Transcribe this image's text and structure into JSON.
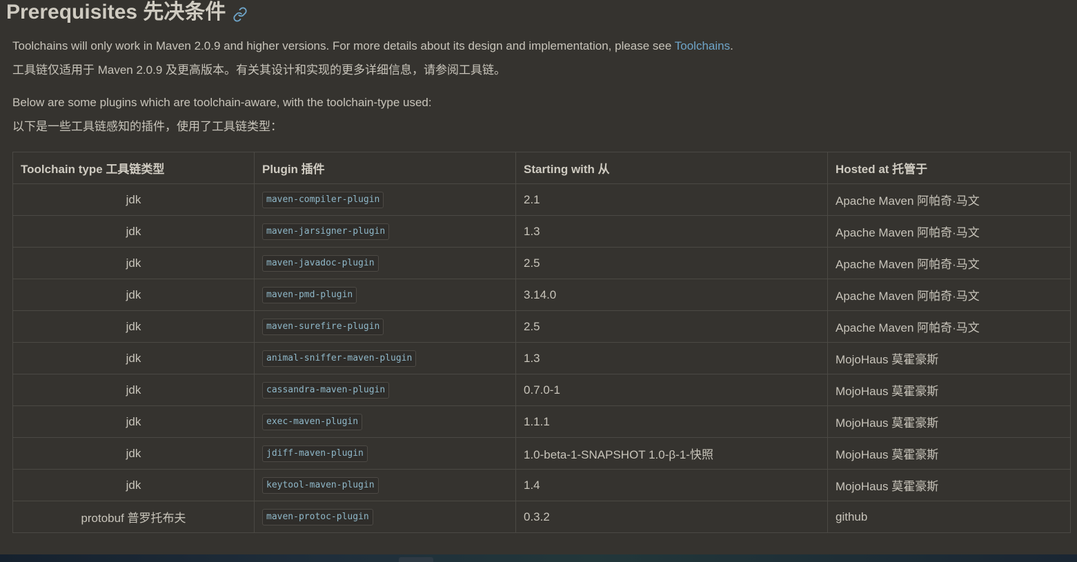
{
  "heading": {
    "text": "Prerequisites 先决条件",
    "icon": "link-icon"
  },
  "paragraphs": {
    "p1_before": "Toolchains will only work in Maven 2.0.9 and higher versions. For more details about its design and implementation, please see ",
    "p1_link": "Toolchains",
    "p1_after": ".",
    "p2": "工具链仅适用于 Maven 2.0.9 及更高版本。有关其设计和实现的更多详细信息，请参阅工具链。",
    "p3": "Below are some plugins which are toolchain-aware, with the toolchain-type used:",
    "p4": "以下是一些工具链感知的插件，使用了工具链类型："
  },
  "table": {
    "headers": {
      "type": "Toolchain type 工具链类型",
      "plugin": "Plugin 插件",
      "starting": "Starting with 从",
      "hosted": "Hosted at 托管于"
    },
    "rows": [
      {
        "type": "jdk",
        "plugin": "maven-compiler-plugin",
        "starting": "2.1",
        "hosted": "Apache Maven 阿帕奇·马文"
      },
      {
        "type": "jdk",
        "plugin": "maven-jarsigner-plugin",
        "starting": "1.3",
        "hosted": "Apache Maven 阿帕奇·马文"
      },
      {
        "type": "jdk",
        "plugin": "maven-javadoc-plugin",
        "starting": "2.5",
        "hosted": "Apache Maven 阿帕奇·马文"
      },
      {
        "type": "jdk",
        "plugin": "maven-pmd-plugin",
        "starting": "3.14.0",
        "hosted": "Apache Maven 阿帕奇·马文"
      },
      {
        "type": "jdk",
        "plugin": "maven-surefire-plugin",
        "starting": "2.5",
        "hosted": "Apache Maven 阿帕奇·马文"
      },
      {
        "type": "jdk",
        "plugin": "animal-sniffer-maven-plugin",
        "starting": "1.3",
        "hosted": "MojoHaus 莫霍豪斯"
      },
      {
        "type": "jdk",
        "plugin": "cassandra-maven-plugin",
        "starting": "0.7.0-1",
        "hosted": "MojoHaus 莫霍豪斯"
      },
      {
        "type": "jdk",
        "plugin": "exec-maven-plugin",
        "starting": "1.1.1",
        "hosted": "MojoHaus 莫霍豪斯"
      },
      {
        "type": "jdk",
        "plugin": "jdiff-maven-plugin",
        "starting": "1.0-beta-1-SNAPSHOT 1.0-β-1-快照",
        "hosted": "MojoHaus 莫霍豪斯"
      },
      {
        "type": "jdk",
        "plugin": "keytool-maven-plugin",
        "starting": "1.4",
        "hosted": "MojoHaus 莫霍豪斯"
      },
      {
        "type": "protobuf 普罗托布夫",
        "plugin": "maven-protoc-plugin",
        "starting": "0.3.2",
        "hosted": "github"
      }
    ]
  },
  "colors": {
    "background": "#35332f",
    "text": "#c8c4ba",
    "link": "#6fa5c9",
    "code_text": "#8fb8c9",
    "border": "#4b4944"
  }
}
